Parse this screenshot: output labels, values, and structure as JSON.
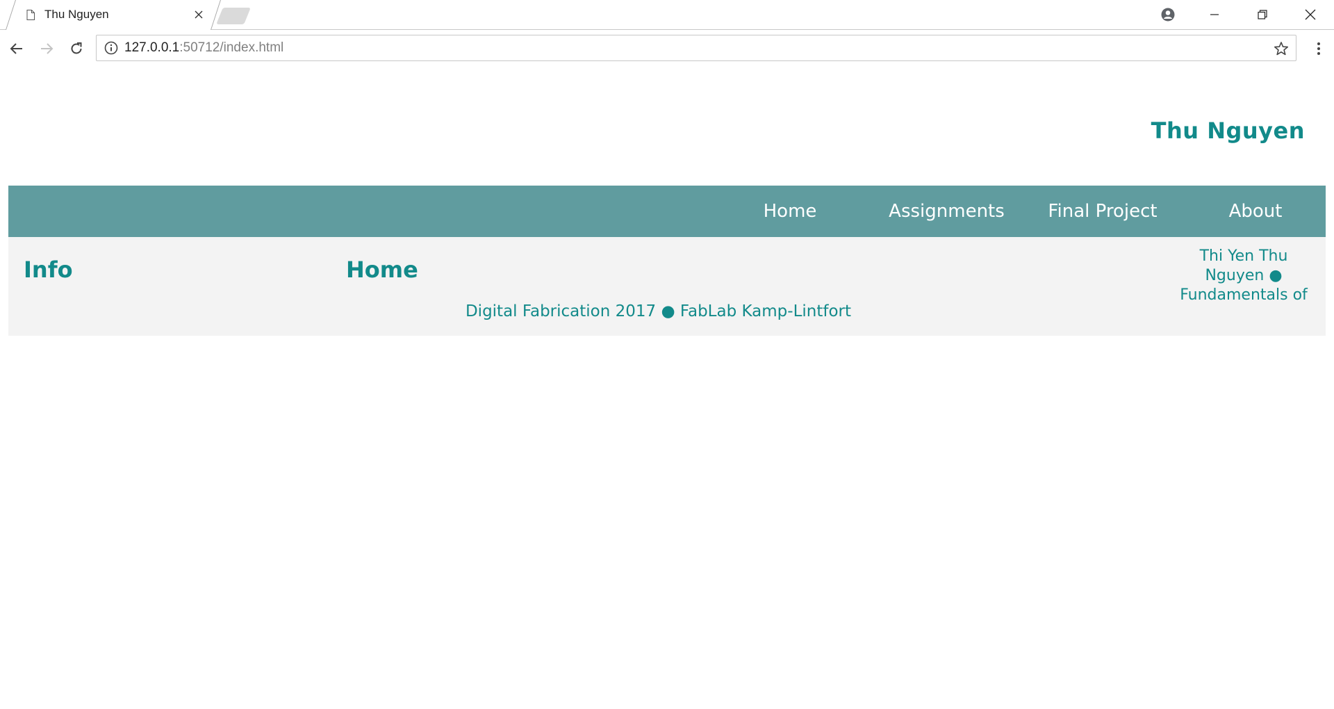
{
  "browser": {
    "tab_title": "Thu Nguyen",
    "url_host": "127.0.0.1",
    "url_rest": ":50712/index.html",
    "icons": [
      "page-icon",
      "close-icon",
      "profile-icon",
      "minimize-icon",
      "restore-icon",
      "close-window-icon",
      "back-icon",
      "forward-icon",
      "reload-icon",
      "info-icon",
      "star-icon",
      "menu-icon"
    ]
  },
  "site": {
    "title": "Thu Nguyen",
    "accent_color": "#128a8a",
    "nav_color": "#609c9f",
    "nav": {
      "items": [
        {
          "label": "Home"
        },
        {
          "label": "Assignments"
        },
        {
          "label": "Final Project"
        },
        {
          "label": "About"
        }
      ]
    },
    "info_heading": "Info",
    "home_heading": "Home",
    "footer": {
      "right_text_1": "Thi Yen Thu",
      "right_text_2": "Nguyen ●",
      "right_text_3": "Fundamentals of",
      "line": "Digital Fabrication 2017 ● FabLab Kamp-Lintfort"
    }
  }
}
